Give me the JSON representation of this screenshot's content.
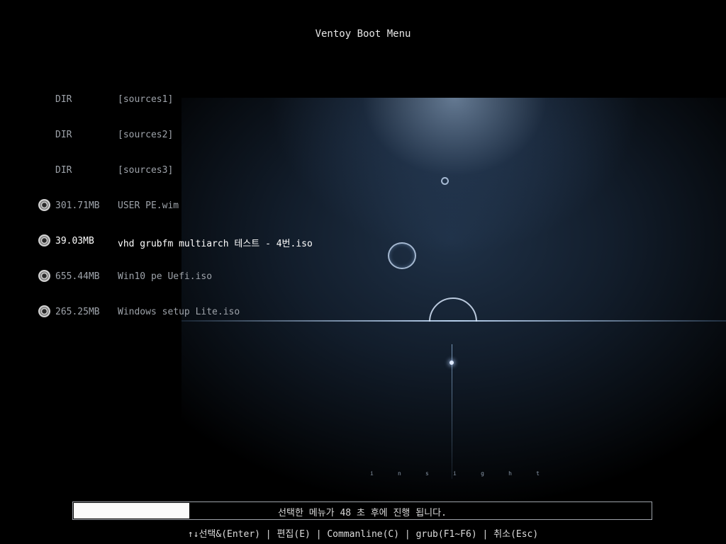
{
  "title": "Ventoy Boot Menu",
  "menu": {
    "selected_index": 4,
    "items": [
      {
        "col1": "DIR",
        "col2": "[sources1]",
        "icon": "none"
      },
      {
        "col1": "DIR",
        "col2": "[sources2]",
        "icon": "none"
      },
      {
        "col1": "DIR",
        "col2": "[sources3]",
        "icon": "none"
      },
      {
        "col1": "301.71MB",
        "col2": "USER PE.wim",
        "icon": "disc-icon"
      },
      {
        "col1": "39.03MB",
        "col2": "vhd grubfm multiarch 테스트 - 4번.iso",
        "icon": "disc-icon"
      },
      {
        "col1": "655.44MB",
        "col2": "Win10 pe Uefi.iso",
        "icon": "disc-icon"
      },
      {
        "col1": "265.25MB",
        "col2": "Windows setup Lite.iso",
        "icon": "disc-icon"
      }
    ]
  },
  "background_text": [
    "i",
    "n",
    "s",
    "i",
    "g",
    "h",
    "t"
  ],
  "timeout": {
    "text": "선택한 메뉴가 48 초 후에 진행 됩니다.",
    "progress_fraction": 0.2
  },
  "hint": "↑↓선택&(Enter) | 편집(E) | Commanline(C) | grub(F1~F6) | 취소(Esc)",
  "colors": {
    "background": "#000000",
    "text": "#9ea3aa",
    "selected_text": "#ffffff",
    "progress_fill": "#fafafa"
  }
}
